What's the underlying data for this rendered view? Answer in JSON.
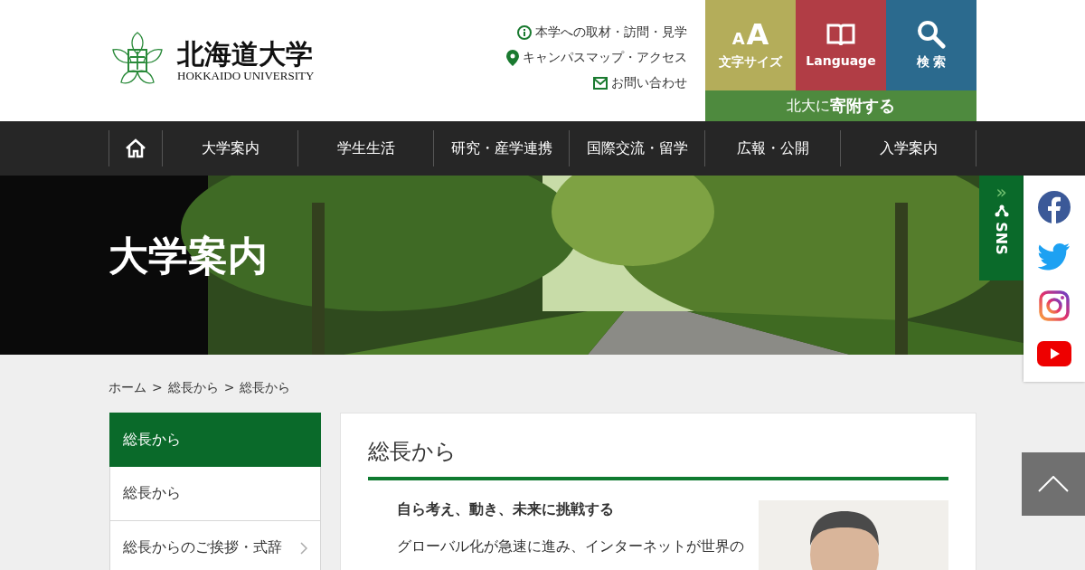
{
  "logo": {
    "name": "北海道大学",
    "subtitle": "HOKKAIDO UNIVERSITY"
  },
  "utility_links": [
    {
      "kind": "info",
      "label": "本学への取材・訪問・見学"
    },
    {
      "kind": "pin",
      "label": "キャンパスマップ・アクセス"
    },
    {
      "kind": "mail",
      "label": "お問い合わせ"
    }
  ],
  "tool_buttons": [
    {
      "kind": "size",
      "small": "A",
      "large": "A",
      "label": "文字サイズ"
    },
    {
      "kind": "language",
      "label": "Language"
    },
    {
      "kind": "search",
      "label": "検 索"
    }
  ],
  "donate": {
    "prefix": "北大に",
    "emphasis": "寄附する"
  },
  "nav": [
    "大学案内",
    "学生生活",
    "研究・産学連携",
    "国際交流・留学",
    "広報・公開",
    "入学案内"
  ],
  "hero": {
    "title": "大学案内"
  },
  "sns_tab": {
    "chevron": "»",
    "label": "SNS"
  },
  "social": [
    {
      "kind": "facebook"
    },
    {
      "kind": "twitter"
    },
    {
      "kind": "instagram"
    },
    {
      "kind": "youtube"
    }
  ],
  "breadcrumb": [
    "ホーム",
    ">",
    "総長から",
    ">",
    "総長から"
  ],
  "sidebar": [
    {
      "label": "総長から",
      "selected": true,
      "has_children": false
    },
    {
      "label": "総長から",
      "selected": false,
      "has_children": false
    },
    {
      "label": "総長からのご挨拶・式辞",
      "selected": false,
      "has_children": true
    }
  ],
  "article": {
    "title": "総長から",
    "heading": "自ら考え、動き、未来に挑戦する",
    "paragraph": "グローバル化が急速に進み、インターネットが世界の"
  }
}
